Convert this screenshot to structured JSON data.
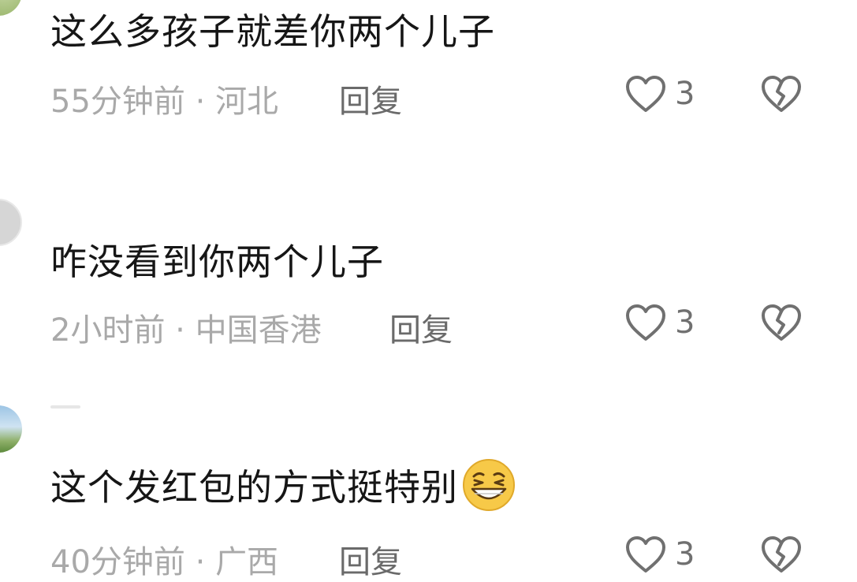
{
  "comments": [
    {
      "username": "",
      "text": "这么多孩子就差你两个儿子",
      "time": "55分钟前",
      "separator": "·",
      "location": "河北",
      "reply_label": "回复",
      "like_count": "3"
    },
    {
      "username": "",
      "text": "咋没看到你两个儿子",
      "time": "2小时前",
      "separator": "·",
      "location": "中国香港",
      "reply_label": "回复",
      "like_count": "3"
    },
    {
      "username": "",
      "text": "这个发红包的方式挺特别",
      "time": "40分钟前",
      "separator": "·",
      "location": "广西",
      "reply_label": "回复",
      "like_count": "3",
      "emoji": "grinning-squint-emoji"
    }
  ],
  "colors": {
    "text": "#161616",
    "meta": "#a9a9a9",
    "reply": "#6a6a6a",
    "icon": "#707070",
    "emoji_face": "#f7c948"
  },
  "icons": {
    "like": "heart-outline-icon",
    "dislike": "broken-heart-icon"
  }
}
